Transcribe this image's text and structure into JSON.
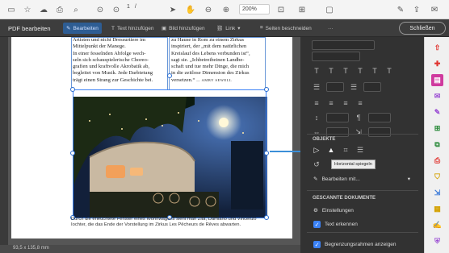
{
  "toolbar": {
    "page_current": "1",
    "page_sep": "/",
    "zoom": "200%"
  },
  "editbar": {
    "title": "PDF bearbeiten",
    "tools": [
      "Bearbeiten",
      "Text hinzufügen",
      "Bild hinzufügen",
      "Link",
      "Seiten beschneiden"
    ],
    "close": "Schließen"
  },
  "document": {
    "col1": [
      "Artisten und nicht Dressurtiere im",
      "Mittelpunkt der Manege.",
      "In einer fesselnden Abfolge wech-",
      "seln sich schauspielerische Choreo-",
      "grafien und kraftvolle Akrobatik ab,",
      "begleitet von Musik. Jede Darbietung",
      "trägt einen Strang zur Geschichte bei."
    ],
    "col2": [
      "zu Hause in Rom zu einem Zirkus",
      "inspiriert, der „mit dem natürlichen",
      "Kreislauf des Lebens verbunden ist“,",
      "sagt sie. „Ichbetreibeinen Landbe-",
      "schaft und tue mehr Dinge, die mich",
      "in die zeitlose Dimension des Zirkus",
      "versetzen.“"
    ],
    "col2_author": "— AMBY SEWELL",
    "caption": "Durch die erleuchtete Fenster eines Wohnwagens sieht man Zita, Damiano und Vincenzo Iochter, die das Ende der Vorstellung im Zirkus Les Pêcheurs de Rêves abwarten.",
    "status": "93,5 x 135,8 mm"
  },
  "panel": {
    "section_objects": "OBJEKTE",
    "tooltip": "Horizontal spiegeln",
    "edit_with": "Bearbeiten mit...",
    "section_scanned": "GESCANNTE DOKUMENTE",
    "settings": "Einstellungen",
    "recognize_text": "Text erkennen",
    "bounding_boxes": "Begrenzungsrahmen anzeigen"
  },
  "colors": {
    "accent": "#2e5d93",
    "selection": "#3b82f6"
  }
}
